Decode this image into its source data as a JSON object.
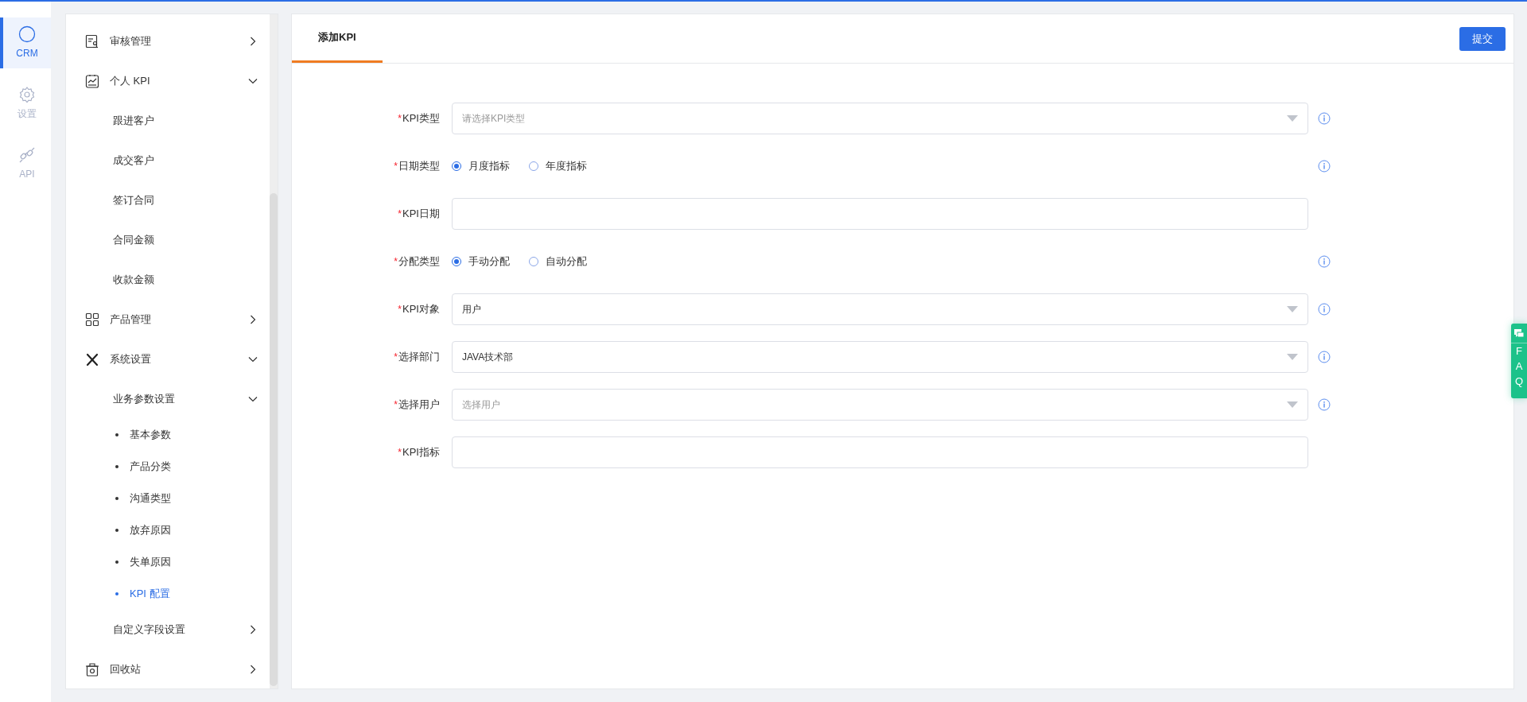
{
  "rail": [
    {
      "label": "CRM",
      "selected": true
    },
    {
      "label": "设置",
      "selected": false
    },
    {
      "label": "API",
      "selected": false
    }
  ],
  "sidebar": {
    "items": [
      {
        "label": "审核管理",
        "expanded": false
      },
      {
        "label": "个人 KPI",
        "expanded": true,
        "children": [
          {
            "label": "跟进客户",
            "selected": false
          },
          {
            "label": "成交客户",
            "selected": false
          },
          {
            "label": "签订合同",
            "selected": false
          },
          {
            "label": "合同金额",
            "selected": false
          },
          {
            "label": "收款金额",
            "selected": false
          }
        ]
      },
      {
        "label": "产品管理",
        "expanded": false
      },
      {
        "label": "系统设置",
        "expanded": true,
        "children": [
          {
            "label": "业务参数设置",
            "expanded": true,
            "children": [
              {
                "label": "基本参数",
                "selected": false
              },
              {
                "label": "产品分类",
                "selected": false
              },
              {
                "label": "沟通类型",
                "selected": false
              },
              {
                "label": "放弃原因",
                "selected": false
              },
              {
                "label": "失单原因",
                "selected": false
              },
              {
                "label": "KPI 配置",
                "selected": true
              }
            ]
          },
          {
            "label": "自定义字段设置",
            "expanded": false
          }
        ]
      },
      {
        "label": "回收站",
        "expanded": false
      }
    ]
  },
  "tabs": [
    {
      "label": "添加KPI",
      "selected": true
    }
  ],
  "submit_button": "提交",
  "form": {
    "fields": [
      {
        "kind": "select",
        "mark": "*",
        "label": "KPI类型",
        "placeholder": "请选择KPI类型",
        "info": true
      },
      {
        "kind": "radio",
        "mark": "*",
        "label": "日期类型",
        "options": [
          {
            "label": "月度指标",
            "selected": true
          },
          {
            "label": "年度指标",
            "selected": false
          }
        ],
        "info": true
      },
      {
        "kind": "text",
        "mark": "*",
        "label": "KPI日期",
        "info": false
      },
      {
        "kind": "radio",
        "mark": "*",
        "label": "分配类型",
        "options": [
          {
            "label": "手动分配",
            "selected": true
          },
          {
            "label": "自动分配",
            "selected": false
          }
        ],
        "info": true
      },
      {
        "kind": "select",
        "mark": "*",
        "label": "KPI对象",
        "value": "用户",
        "info": true
      },
      {
        "kind": "select",
        "mark": "*",
        "label": "选择部门",
        "value": "JAVA技术部",
        "info": true
      },
      {
        "kind": "select",
        "mark": "*",
        "label": "选择用户",
        "placeholder": "选择用户",
        "info": true
      },
      {
        "kind": "text",
        "mark": "*",
        "label": "KPI指标",
        "info": false
      }
    ]
  },
  "faq_tab": [
    "F",
    "A",
    "Q"
  ]
}
